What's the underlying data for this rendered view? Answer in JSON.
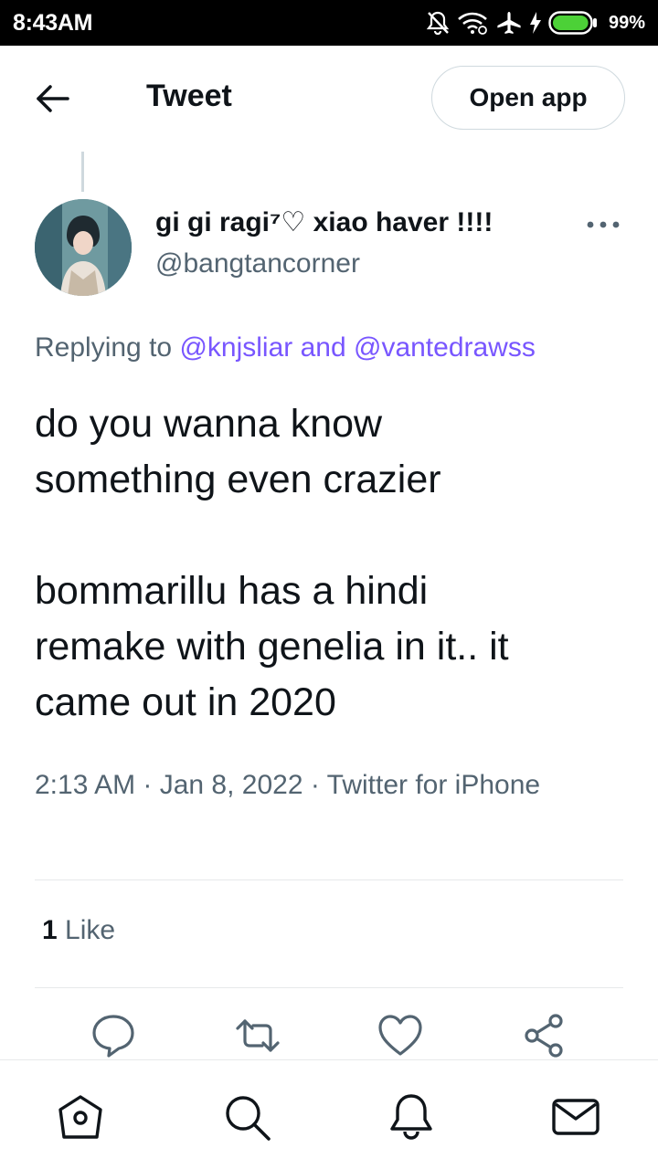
{
  "status_bar": {
    "time": "8:43AM",
    "battery_pct": "99%",
    "battery_level": 0.99
  },
  "header": {
    "title": "Tweet",
    "open_app_label": "Open app"
  },
  "author": {
    "name": "gi gi ragi⁷♡ xiao haver !!!!",
    "handle": "@bangtancorner"
  },
  "replying": {
    "prefix": "Replying to ",
    "mention1": "@knjsliar",
    "joiner": " and ",
    "mention2": "@vantedrawss"
  },
  "tweet": {
    "text": "do you wanna know\nsomething even crazier\n\nbommarillu has a hindi\nremake with genelia in it.. it\ncame out in 2020"
  },
  "meta": {
    "timestamp": "2:13 AM · Jan 8, 2022 · Twitter for iPhone"
  },
  "stats": {
    "like_count": "1",
    "like_label": " Like"
  },
  "colors": {
    "mention": "#7856ff",
    "secondary_text": "#536471",
    "primary_text": "#0f1419",
    "battery": "#4cd137"
  },
  "icons": {
    "header": [
      "back-arrow-icon"
    ],
    "actions": [
      "reply-icon",
      "retweet-icon",
      "like-icon",
      "share-icon"
    ],
    "nav": [
      "home-icon",
      "search-icon",
      "notifications-icon",
      "messages-icon"
    ]
  }
}
